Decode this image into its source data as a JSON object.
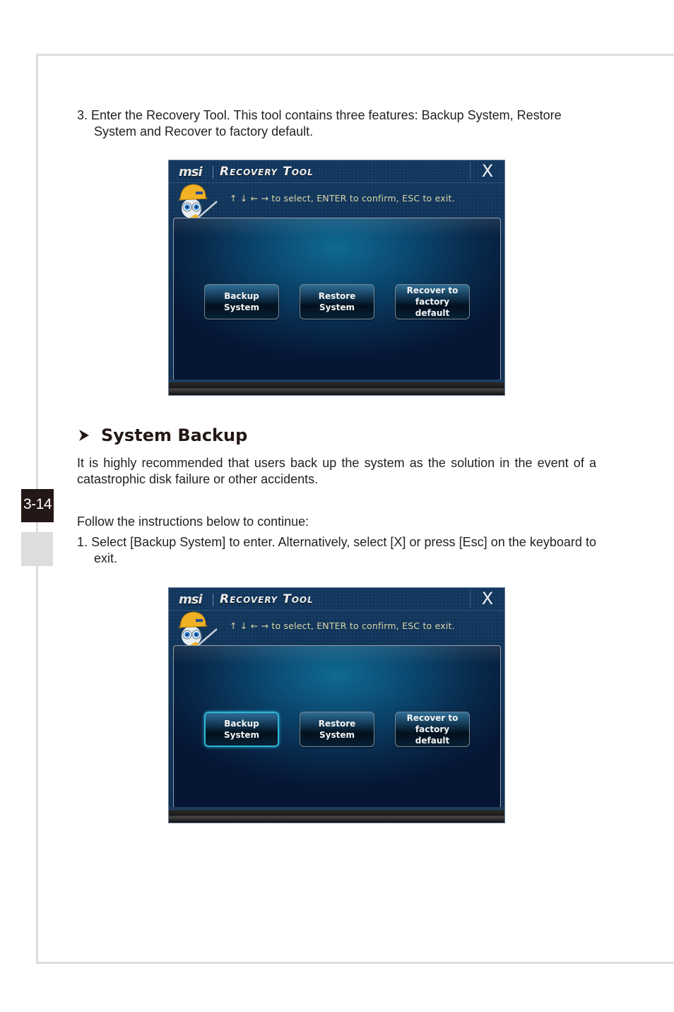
{
  "page": {
    "number_tab": "3-14"
  },
  "step3": {
    "text": "3. Enter the Recovery Tool. This tool contains three features: Backup System, Restore System and Recover to factory default."
  },
  "section": {
    "heading_icon": "chevron-right-icon",
    "heading": "System Backup",
    "intro": "It is highly recommended that users back up the system as the solution in the event of a catastrophic disk failure or other accidents.",
    "follow": "Follow the instructions below to continue:",
    "step1": "1. Select [Backup System] to enter. Alternatively, select [X] or press [Esc] on the keyboard to exit."
  },
  "recovery_tool": {
    "brand": "msi",
    "title": "Recovery Tool",
    "close_label": "X",
    "hint": "↑ ↓ ← → to select, ENTER to confirm, ESC to exit.",
    "mascot_icon": "mascot-hardhat-screwdriver-icon",
    "buttons": [
      {
        "label": "Backup System"
      },
      {
        "label": "Restore System"
      },
      {
        "label": "Recover to factory default",
        "line1": "Recover to",
        "line2": "factory default"
      }
    ],
    "colors": {
      "hint_text": "#d8d7a6",
      "selected_border": "#2fb6d4",
      "window_bg": "#12375e"
    }
  },
  "screenshots": [
    {
      "selected_button": null
    },
    {
      "selected_button": "Backup System"
    }
  ]
}
